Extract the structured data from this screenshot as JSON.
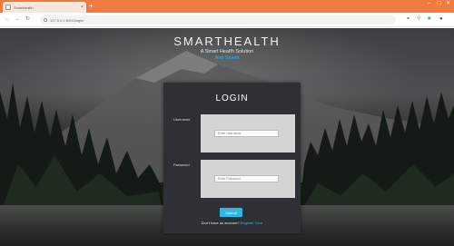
{
  "browser": {
    "tab_title": "Smarthealth",
    "tab_close": "×",
    "new_tab": "+",
    "url": "127.0.0.1:8000/login/",
    "window_controls": [
      "–",
      "▢",
      "✕"
    ],
    "nav_icons": [
      "back-arrow-icon",
      "forward-arrow-icon",
      "reload-icon"
    ],
    "toolbar_icons": [
      "key-icon",
      "zoom-icon",
      "star-icon",
      "account-icon"
    ],
    "accent_color": "#f07a3f"
  },
  "brand": {
    "title": "SMARTHEALTH",
    "tagline": "A Smart Health Solution",
    "slogan": "And Saved",
    "slogan_color": "#2fb7e6"
  },
  "login": {
    "heading": "LOGIN",
    "username_label": "Username",
    "username_placeholder": "Enter Username",
    "username_value": "",
    "password_label": "Password",
    "password_placeholder": "Enter Password",
    "password_value": "",
    "submit_label": "Submit",
    "signup_prompt": "Don't have an account?",
    "signup_link": "Register Here"
  }
}
